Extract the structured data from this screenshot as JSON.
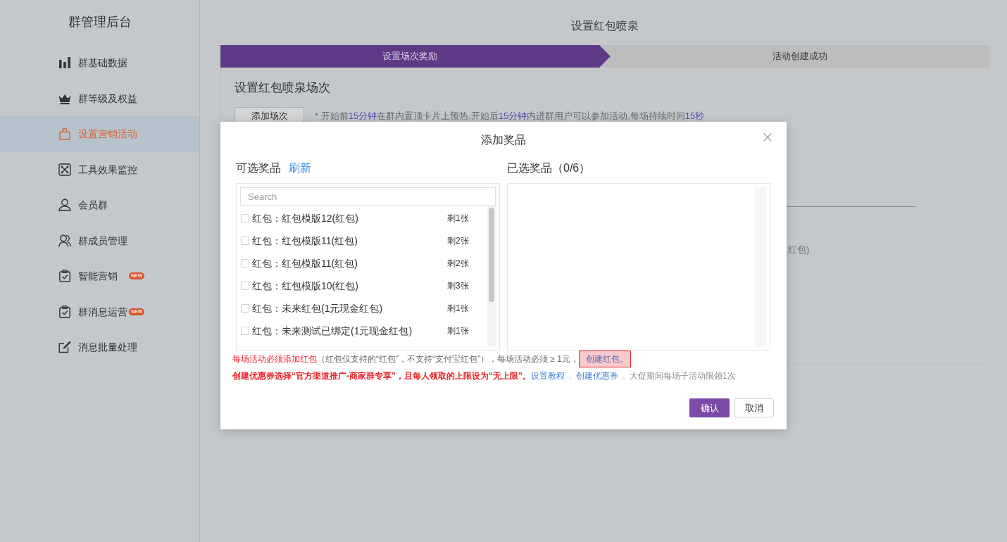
{
  "sidebar": {
    "title": "群管理后台",
    "items": [
      {
        "label": "群基础数据",
        "selected": false
      },
      {
        "label": "群等级及权益",
        "selected": false
      },
      {
        "label": "设置营销活动",
        "selected": true
      },
      {
        "label": "工具效果监控",
        "selected": false
      },
      {
        "label": "会员群",
        "selected": false
      },
      {
        "label": "群成员管理",
        "selected": false
      },
      {
        "label": "智能营销",
        "selected": false,
        "badge": "NEW"
      },
      {
        "label": "群消息运营",
        "selected": false,
        "badge": "NEW"
      },
      {
        "label": "消息批量处理",
        "selected": false
      }
    ]
  },
  "page_title": "设置红包喷泉",
  "steps": [
    {
      "label": "设置场次奖励",
      "selected": true
    },
    {
      "label": "活动创建成功",
      "selected": false
    }
  ],
  "session_card": {
    "title": "设置红包喷泉场次",
    "add_button": "添加场次",
    "hint": [
      {
        "text": "* 开始前",
        "highlight": false
      },
      {
        "text": "15分钟",
        "highlight": true
      },
      {
        "text": "在群内置顶卡片上预热,开始后",
        "highlight": false
      },
      {
        "text": "15分钟",
        "highlight": true
      },
      {
        "text": "内进群用户可以参加活动,每场持续时间",
        "highlight": false
      },
      {
        "text": "15秒",
        "highlight": true
      }
    ],
    "covered_text": "红包)"
  },
  "dialog": {
    "title": "添加奖品",
    "available": {
      "title": "可选奖品",
      "refresh_link": "刷新",
      "search": {
        "placeholder": "Search"
      },
      "items": [
        {
          "label": "红包：红包模版12(红包)",
          "remaining": "剩1张",
          "checked": false
        },
        {
          "label": "红包：红包模版11(红包)",
          "remaining": "剩2张",
          "checked": false
        },
        {
          "label": "红包：红包模版11(红包)",
          "remaining": "剩2张",
          "checked": false
        },
        {
          "label": "红包：红包模版10(红包)",
          "remaining": "剩3张",
          "checked": false
        },
        {
          "label": "红包：未来红包(1元现金红包)",
          "remaining": "剩1张",
          "checked": false
        },
        {
          "label": "红包：未来测试已绑定(1元现金红包)",
          "remaining": "剩1张",
          "checked": false
        }
      ]
    },
    "chosen": {
      "title": "已选奖品（0/6）"
    },
    "notices": [
      {
        "segments": [
          {
            "kind": "warning",
            "text": "每场活动必须添加红包"
          },
          {
            "kind": "plain",
            "text": "（红包仅支持的“红包”，不支持“支付宝红包”），每场活动必须 ≥ 1元，"
          },
          {
            "kind": "marked_link",
            "text": "创建红包。"
          }
        ]
      },
      {
        "segments": [
          {
            "kind": "warning_bold",
            "text": "创建优惠券选择“官方渠道推广-商家群专享”，且每人领取的上限设为“无上限”。"
          },
          {
            "kind": "link",
            "text": "设置教程"
          },
          {
            "kind": "separator",
            "text": "，"
          },
          {
            "kind": "link",
            "text": "创建优惠券"
          },
          {
            "kind": "separator",
            "text": "，"
          },
          {
            "kind": "muted",
            "text": "大促期间每场子活动限领1次"
          }
        ]
      }
    ],
    "buttons": [
      {
        "label": "确认",
        "kind": "primary"
      },
      {
        "label": "取消",
        "kind": "default"
      }
    ]
  }
}
